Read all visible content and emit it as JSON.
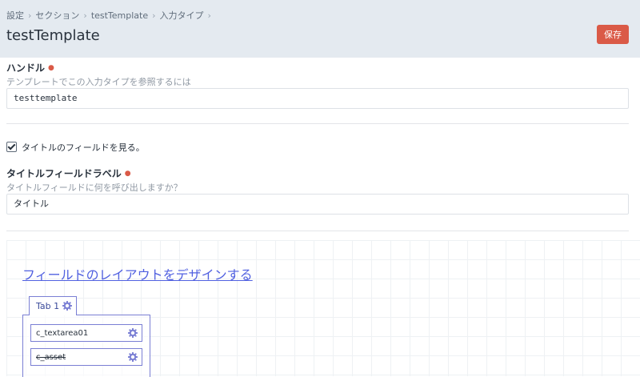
{
  "header": {
    "breadcrumbs": [
      "設定",
      "セクション",
      "testTemplate",
      "入力タイプ"
    ],
    "title": "testTemplate",
    "save_label": "保存"
  },
  "handle": {
    "label": "ハンドル",
    "description": "テンプレートでこの入力タイプを参照するには",
    "value": "testtemplate"
  },
  "title_field": {
    "checkbox_label": "タイトルのフィールドを見る。",
    "checked": true,
    "label": "タイトルフィールドラベル",
    "description": "タイトルフィールドに何を呼び出しますか？",
    "value": "タイトル"
  },
  "layout": {
    "link_label": "フィールドのレイアウトをデザインする",
    "tab_label": "Tab 1",
    "fields": [
      {
        "name": "c_textarea01"
      },
      {
        "name": "c_asset"
      }
    ]
  },
  "colors": {
    "accent_save": "#da5a47",
    "link": "#5161e0",
    "designer_border": "#7a7fd4"
  }
}
